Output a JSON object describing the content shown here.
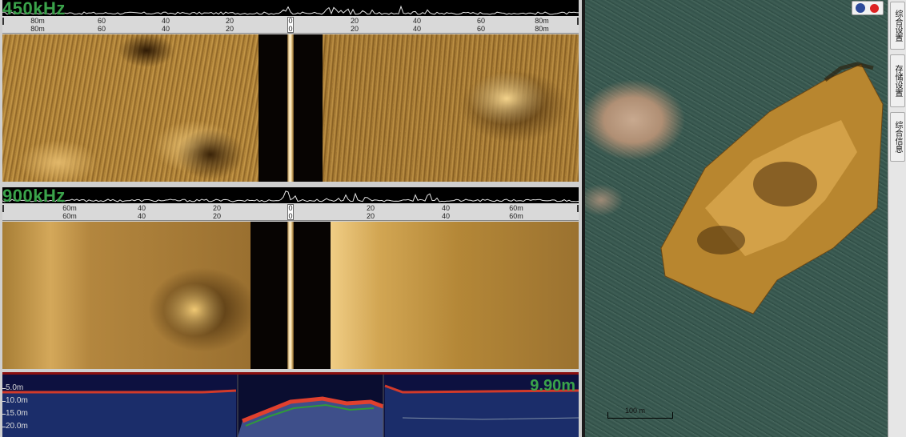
{
  "sonar_450": {
    "frequency_label": "450kHz",
    "ruler_top": [
      "80m",
      "60",
      "40",
      "20",
      "0",
      "20",
      "40",
      "60",
      "80m"
    ],
    "ruler_bottom": [
      "80m",
      "60",
      "40",
      "20",
      "0",
      "20",
      "40",
      "60",
      "80m"
    ]
  },
  "sonar_900": {
    "frequency_label": "900kHz",
    "ruler_top": [
      "60m",
      "40",
      "20",
      "0",
      "20",
      "40",
      "60m"
    ],
    "ruler_bottom": [
      "60m",
      "40",
      "20",
      "0",
      "20",
      "40",
      "60m"
    ]
  },
  "depth_profile": {
    "depth_readout": "9.90m",
    "scale_labels": [
      "5.0m",
      "10.0m",
      "15.0m",
      "20.0m"
    ]
  },
  "map": {
    "scale_bar_label": "100 m",
    "north_icon": "compass-north-icon",
    "record_icon": "red-dot-icon"
  },
  "toolbar": {
    "buttons": [
      "综合设置",
      "存储设置",
      "综合信息"
    ]
  },
  "colors": {
    "sonar_gold": "#c89a4a",
    "freq_label_green": "#3aa24a",
    "sea": "#3f5f56"
  }
}
